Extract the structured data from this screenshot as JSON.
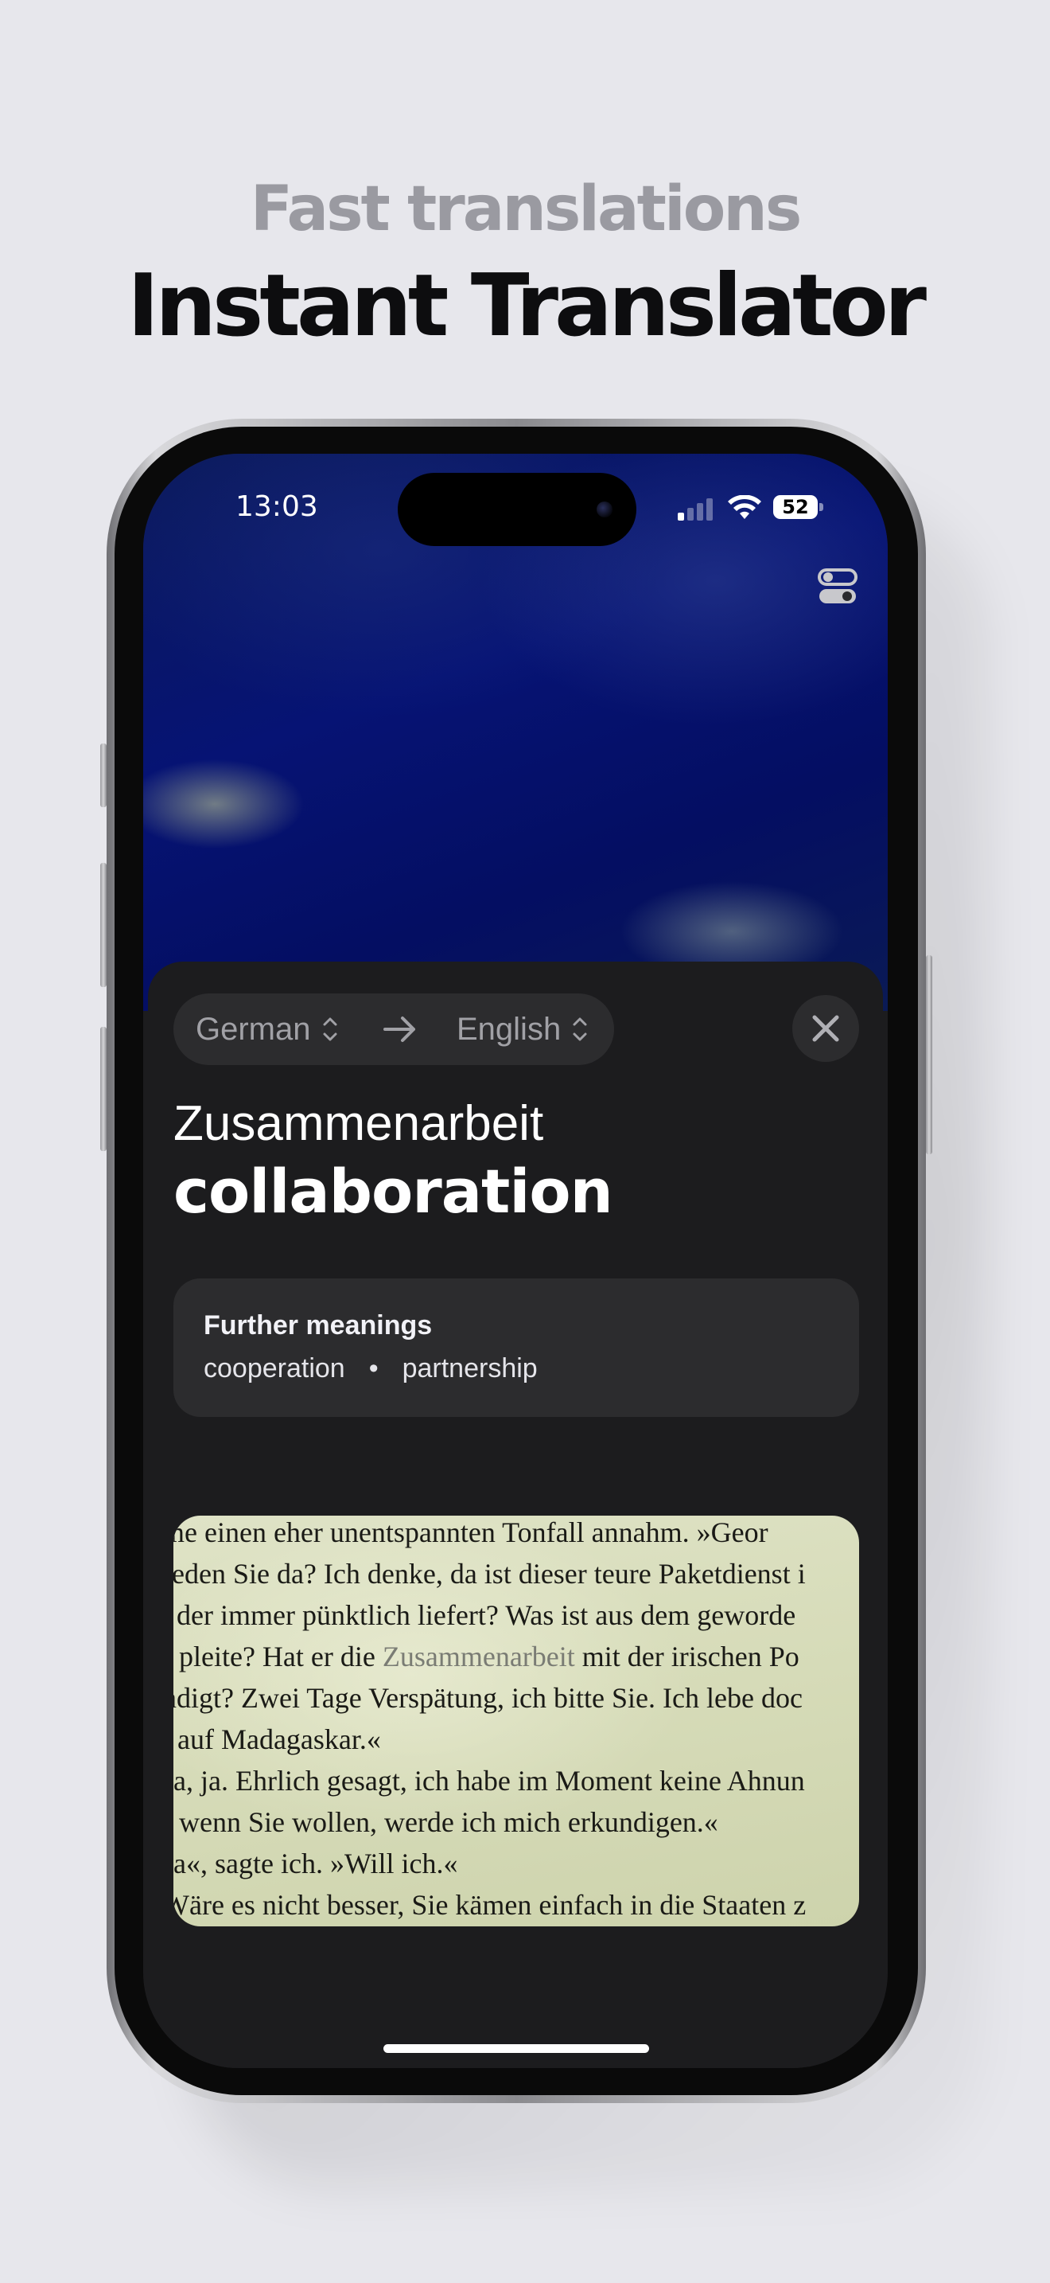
{
  "marketing": {
    "kicker": "Fast translations",
    "headline": "Instant Translator"
  },
  "status_bar": {
    "time": "13:03",
    "battery": "52",
    "icons": [
      "cellular-signal-icon",
      "wifi-icon",
      "battery-icon"
    ]
  },
  "toolbar": {
    "settings_icon": "toggle-settings-icon"
  },
  "translation": {
    "source_language": "German",
    "target_language": "English",
    "source_word": "Zusammenarbeit",
    "translated_word": "collaboration",
    "further_meanings_title": "Further meanings",
    "further_meanings": [
      "cooperation",
      "partnership"
    ],
    "separator": "•"
  },
  "book_text": {
    "lines": [
      {
        "before": "me einen eher unentspannten Tonfall annahm. »Geor",
        "highlight": "",
        "after": ""
      },
      {
        "before": "reden Sie da? Ich denke, da ist dieser teure Paketdienst i",
        "highlight": "",
        "after": ""
      },
      {
        "before": ", der immer pünktlich liefert? Was ist aus dem geworde",
        "highlight": "",
        "after": ""
      },
      {
        "before": "r pleite? Hat er die ",
        "highlight": "Zusammenarbeit",
        "after": " mit der irischen Po"
      },
      {
        "before": "ndigt? Zwei Tage Verspätung, ich bitte Sie. Ich lebe doc",
        "highlight": "",
        "after": ""
      },
      {
        "before": "t auf Madagaskar.«",
        "highlight": "",
        "after": ""
      },
      {
        "before": "Ja, ja. Ehrlich gesagt, ich habe im Moment keine Ahnun",
        "highlight": "",
        "after": ""
      },
      {
        "before": "r wenn Sie wollen, werde ich mich erkundigen.«",
        "highlight": "",
        "after": ""
      },
      {
        "before": "Ja«, sagte ich. »Will ich.«",
        "highlight": "",
        "after": ""
      },
      {
        "before": "Wäre es nicht besser, Sie kämen einfach in die Staaten z",
        "highlight": "",
        "after": ""
      }
    ]
  },
  "colors": {
    "page_background": "#e7e7ec",
    "sheet_background": "#1c1c1e",
    "card_background": "#2c2c2e",
    "kicker": "#9a9aa1",
    "headline": "#0d0d0f"
  }
}
